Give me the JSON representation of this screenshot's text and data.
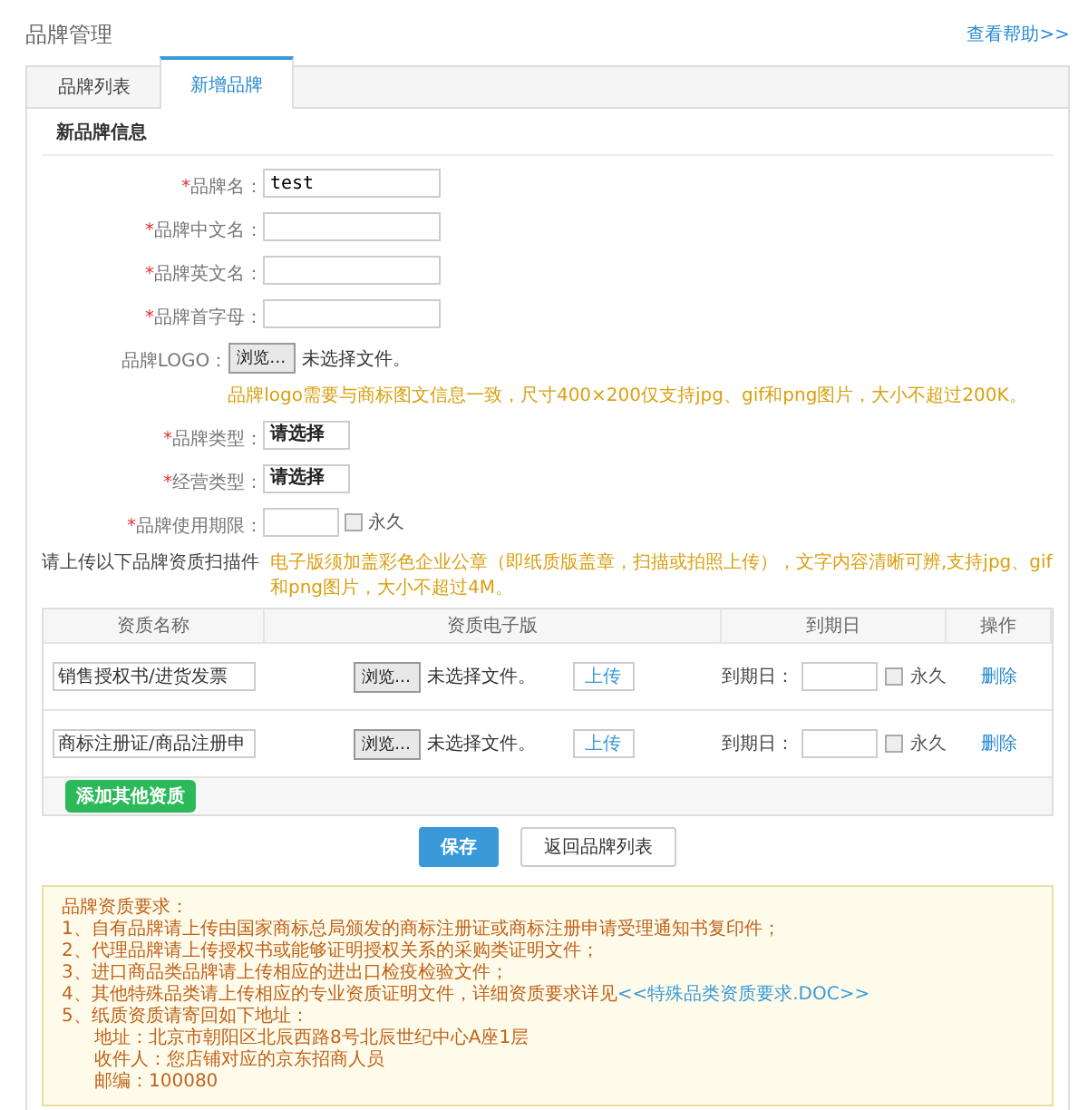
{
  "header": {
    "title": "品牌管理",
    "help_link": "查看帮助>>"
  },
  "tabs": [
    {
      "label": "品牌列表",
      "selected": false
    },
    {
      "label": "新增品牌",
      "selected": true
    }
  ],
  "section_title": "新品牌信息",
  "form": [
    {
      "kind": "text",
      "mark": "*",
      "label": "品牌名：",
      "value": "test"
    },
    {
      "kind": "text",
      "mark": "*",
      "label": "品牌中文名："
    },
    {
      "kind": "text",
      "mark": "*",
      "label": "品牌英文名："
    },
    {
      "kind": "text",
      "mark": "*",
      "label": "品牌首字母："
    },
    {
      "kind": "file",
      "label": "品牌LOGO：",
      "button": "浏览…",
      "file_status": "未选择文件。",
      "hint": "品牌logo需要与商标图文信息一致，尺寸400×200仅支持jpg、gif和png图片，大小不超过200K。"
    },
    {
      "kind": "select",
      "mark": "*",
      "label": "品牌类型：",
      "value": "请选择"
    },
    {
      "kind": "select",
      "mark": "*",
      "label": "经营类型：",
      "value": "请选择"
    },
    {
      "kind": "date",
      "mark": "*",
      "label": "品牌使用期限：",
      "checkbox_label": "永久",
      "checked": false
    }
  ],
  "upload": {
    "title": "请上传以下品牌资质扫描件",
    "hint": "电子版须加盖彩色企业公章（即纸质版盖章，扫描或拍照上传），文字内容清晰可辨,支持jpg、gif和png图片，大小不超过4M。"
  },
  "table": {
    "columns": [
      "资质名称",
      "资质电子版",
      "到期日",
      "操作"
    ],
    "rows": [
      {
        "name": "销售授权书/进货发票",
        "browse": "浏览…",
        "file_status": "未选择文件。",
        "upload": "上传",
        "date_label": "到期日：",
        "checkbox_label": "永久",
        "checked": false,
        "action": "删除"
      },
      {
        "name": "商标注册证/商品注册申",
        "browse": "浏览…",
        "file_status": "未选择文件。",
        "upload": "上传",
        "date_label": "到期日：",
        "checkbox_label": "永久",
        "checked": false,
        "action": "删除"
      }
    ],
    "add_button": "添加其他资质"
  },
  "buttons": {
    "save": "保存",
    "back": "返回品牌列表"
  },
  "notes": {
    "title": "品牌资质要求：",
    "lines": [
      {
        "kind": "item",
        "text": "1、自有品牌请上传由国家商标总局颁发的商标注册证或商标注册申请受理通知书复印件；"
      },
      {
        "kind": "item",
        "text": "2、代理品牌请上传授权书或能够证明授权关系的采购类证明文件；"
      },
      {
        "kind": "item",
        "text": "3、进口商品类品牌请上传相应的进出口检疫检验文件；"
      },
      {
        "kind": "item",
        "text": "4、其他特殊品类请上传相应的专业资质证明文件，详细资质要求详见",
        "link": "<<特殊品类资质要求.DOC>>"
      },
      {
        "kind": "item",
        "text": "5、纸质资质请寄回如下地址："
      },
      {
        "kind": "address",
        "text": "地址：北京市朝阳区北辰西路8号北辰世纪中心A座1层"
      },
      {
        "kind": "address",
        "text": "收件人：您店铺对应的京东招商人员"
      },
      {
        "kind": "address",
        "text": "邮编：100080"
      }
    ]
  }
}
